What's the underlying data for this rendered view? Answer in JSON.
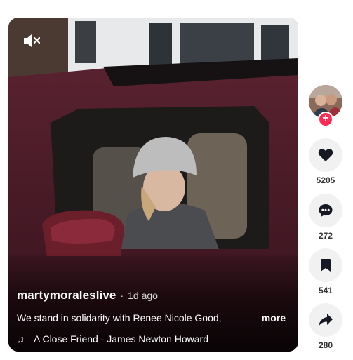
{
  "video": {
    "author": "martymoraleslive",
    "separator": "·",
    "posted": "1d ago",
    "caption": "We stand in solidarity with Renee Nicole Good,",
    "more_label": "more",
    "music": "A Close Friend - James Newton Howard",
    "icons": {
      "mute": "volume-muted-icon",
      "music": "music-note-icon"
    }
  },
  "actions": {
    "likes": "5205",
    "comments": "272",
    "saves": "541",
    "shares": "280",
    "follow_label": "+"
  },
  "colors": {
    "follow_badge": "#fe2c55",
    "action_bg": "#f1f1f2"
  }
}
